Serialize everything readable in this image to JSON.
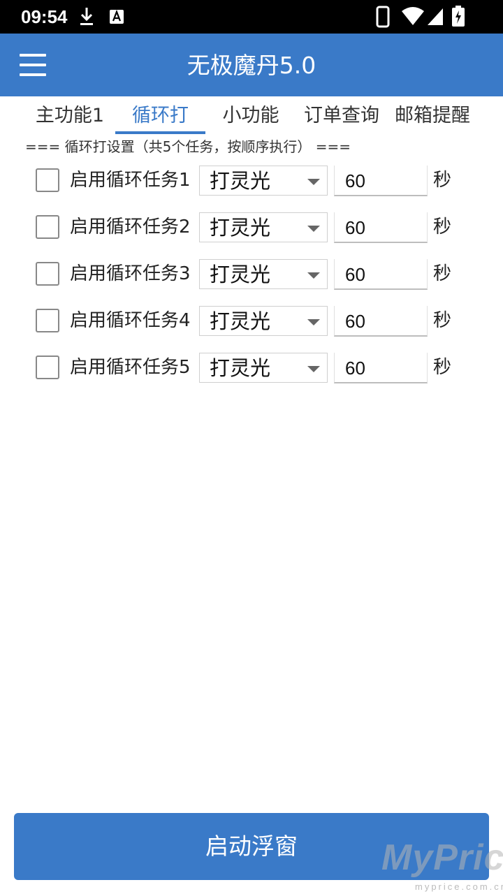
{
  "status_bar": {
    "time": "09:54",
    "icons": [
      "download-icon",
      "font-a-icon",
      "phone-icon",
      "wifi-icon",
      "signal-icon",
      "battery-charging-icon"
    ]
  },
  "app_bar": {
    "title": "无极魔丹5.0",
    "menu_icon": "hamburger-menu-icon",
    "color": "#3a7ac8"
  },
  "tabs": [
    {
      "label": "主功能1",
      "active": false
    },
    {
      "label": "循环打",
      "active": true
    },
    {
      "label": "小功能",
      "active": false
    },
    {
      "label": "订单查询",
      "active": false
    },
    {
      "label": "邮箱提醒",
      "active": false
    }
  ],
  "section_header": "=== 循环打设置（共5个任务，按顺序执行） ===",
  "tasks": [
    {
      "label": "启用循环任务1",
      "checked": false,
      "action": "打灵光",
      "seconds": "60",
      "unit": "秒"
    },
    {
      "label": "启用循环任务2",
      "checked": false,
      "action": "打灵光",
      "seconds": "60",
      "unit": "秒"
    },
    {
      "label": "启用循环任务3",
      "checked": false,
      "action": "打灵光",
      "seconds": "60",
      "unit": "秒"
    },
    {
      "label": "启用循环任务4",
      "checked": false,
      "action": "打灵光",
      "seconds": "60",
      "unit": "秒"
    },
    {
      "label": "启用循环任务5",
      "checked": false,
      "action": "打灵光",
      "seconds": "60",
      "unit": "秒"
    }
  ],
  "start_button": "启动浮窗",
  "watermark": {
    "brand": "MyPrice",
    "url": "myprice.com.cn"
  }
}
